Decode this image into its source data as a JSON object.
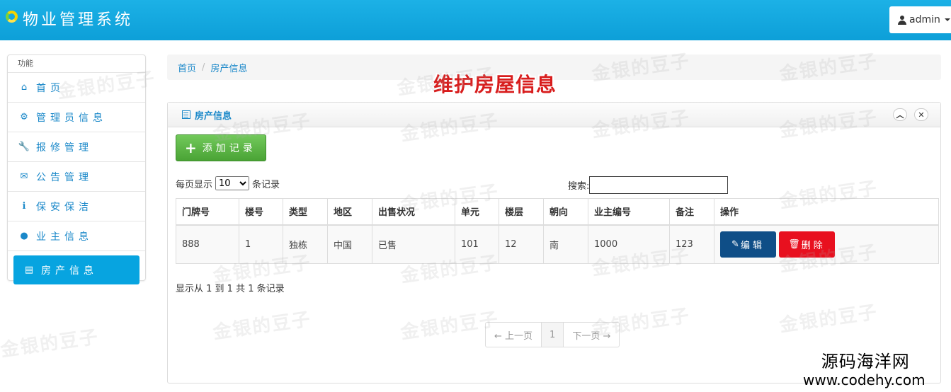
{
  "app": {
    "title": "物业管理系统"
  },
  "user": {
    "name": "admin"
  },
  "sidebar": {
    "heading": "功能",
    "items": [
      {
        "label": "首页",
        "icon": "home-icon",
        "glyph": "⌂"
      },
      {
        "label": "管理员信息",
        "icon": "gear-icon",
        "glyph": "⚙"
      },
      {
        "label": "报修管理",
        "icon": "wrench-icon",
        "glyph": "🔧"
      },
      {
        "label": "公告管理",
        "icon": "envelope-icon",
        "glyph": "✉"
      },
      {
        "label": "保安保洁",
        "icon": "info-icon",
        "glyph": "ℹ"
      },
      {
        "label": "业主信息",
        "icon": "user-icon",
        "glyph": "●"
      },
      {
        "label": "房产信息",
        "icon": "list-icon",
        "glyph": "▤",
        "active": true
      }
    ]
  },
  "breadcrumb": {
    "home": "首页",
    "current": "房产信息"
  },
  "annotation": "维护房屋信息",
  "panel": {
    "title": "房产信息",
    "add_label": "添加记录",
    "length_prefix": "每页显示",
    "length_value": "10",
    "length_suffix": "条记录",
    "search_label": "搜索:",
    "search_value": "",
    "columns": [
      "门牌号",
      "楼号",
      "类型",
      "地区",
      "出售状况",
      "单元",
      "楼层",
      "朝向",
      "业主编号",
      "备注",
      "操作"
    ],
    "rows": [
      {
        "cells": [
          "888",
          "1",
          "独栋",
          "中国",
          "已售",
          "101",
          "12",
          "南",
          "1000",
          "123"
        ]
      }
    ],
    "edit_label": "编辑",
    "delete_label": "删除",
    "info": "显示从 1 到 1 共 1 条记录",
    "pager": {
      "prev": "← 上一页",
      "page": "1",
      "next": "下一页 →"
    }
  },
  "watermark": "金银的豆子",
  "stamp": {
    "line1": "源码海洋网",
    "line2": "www.codehy.com"
  },
  "colors": {
    "topbar": "#0d9fd8",
    "accent": "#1a88c9",
    "add": "#5cb85c",
    "edit": "#0f4e87",
    "delete": "#e8101f",
    "annotation": "#d81d1d"
  }
}
